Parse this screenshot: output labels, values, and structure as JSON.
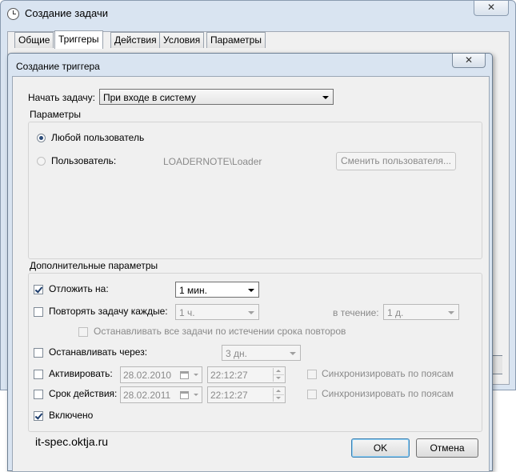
{
  "window": {
    "title": "Создание задачи",
    "close_glyph": "✕",
    "tabs": [
      {
        "label": "Общие"
      },
      {
        "label": "Триггеры"
      },
      {
        "label": "Действия"
      },
      {
        "label": "Условия"
      },
      {
        "label": "Параметры"
      }
    ]
  },
  "dialog": {
    "title": "Создание триггера",
    "close_glyph": "✕",
    "begin_task": {
      "label": "Начать задачу:",
      "value": "При входе в систему"
    },
    "params_group": {
      "title": "Параметры",
      "any_user_label": "Любой пользователь",
      "user_label": "Пользователь:",
      "user_value": "LOADERNOTE\\Loader",
      "change_user_button": "Сменить пользователя..."
    },
    "advanced_group": {
      "title": "Дополнительные параметры",
      "delay": {
        "label": "Отложить на:",
        "value": "1 мин."
      },
      "repeat": {
        "label": "Повторять задачу каждые:",
        "value": "1 ч.",
        "duration_label": "в течение:",
        "duration_value": "1 д."
      },
      "stop_all": {
        "label": "Останавливать все задачи по истечении срока повторов"
      },
      "stop_after": {
        "label": "Останавливать через:",
        "value": "3 дн."
      },
      "activate": {
        "label": "Активировать:",
        "date": "28.02.2010",
        "time": "22:12:27",
        "sync_label": "Синхронизировать по поясам"
      },
      "expire": {
        "label": "Срок действия:",
        "date": "28.02.2011",
        "time": "22:12:27",
        "sync_label": "Синхронизировать по поясам"
      },
      "enabled": {
        "label": "Включено"
      }
    },
    "buttons": {
      "ok": "OK",
      "cancel": "Отмена"
    }
  },
  "watermark": "it-spec.oktja.ru"
}
